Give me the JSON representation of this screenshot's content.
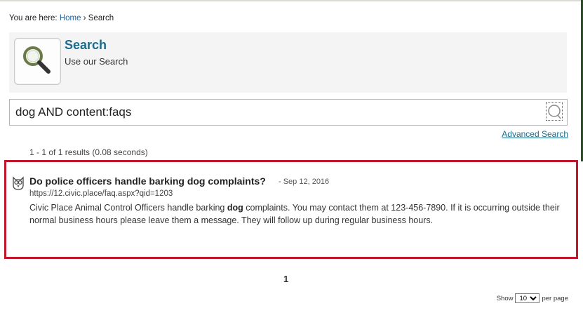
{
  "breadcrumb": {
    "prefix": "You are here: ",
    "home_label": "Home",
    "separator": " › ",
    "current": "Search"
  },
  "header": {
    "title": "Search",
    "subtitle": "Use our Search",
    "icon": "magnifier-icon"
  },
  "search": {
    "query": "dog AND content:faqs",
    "button_icon": "search-icon",
    "advanced_link": "Advanced Search"
  },
  "results": {
    "summary": "1 - 1 of 1 results (0.08 seconds)",
    "items": [
      {
        "title": "Do police officers handle barking dog complaints?",
        "date": "- Sep 12, 2016",
        "url": "https://12.civic.place/faq.aspx?qid=1203",
        "snippet_before": "Civic Place Animal Control Officers handle barking ",
        "snippet_highlight": "dog",
        "snippet_after": " complaints. You may contact them at 123-456-7890. If it is occurring outside their normal business hours please leave them a message. They will follow up during regular business hours.",
        "icon": "owl-icon"
      }
    ]
  },
  "pagination": {
    "current_page": "1"
  },
  "per_page": {
    "show_label": "Show",
    "selected": "10",
    "after_label": "per page"
  },
  "colors": {
    "highlight_border": "#c0172d",
    "title_teal": "#1b6b8c",
    "link_blue": "#1f5f9c"
  }
}
